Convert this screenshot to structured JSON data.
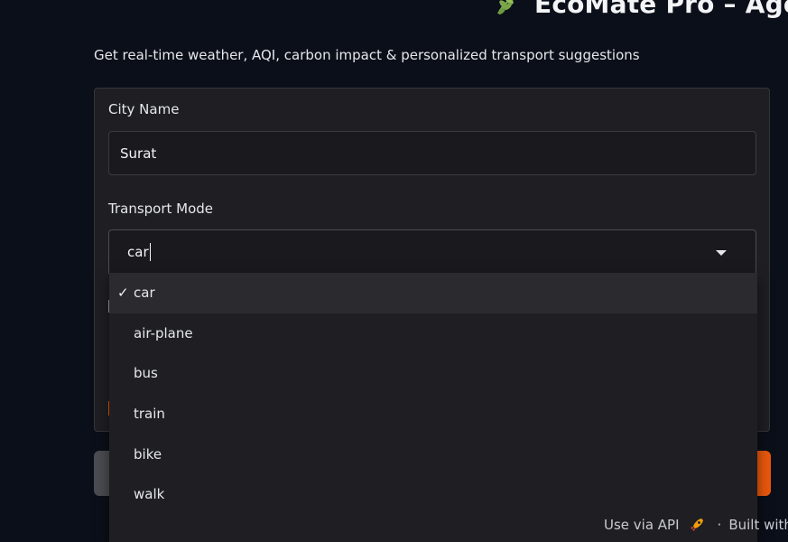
{
  "app": {
    "title": "EcoMate Pro – Agent",
    "subtitle": "Get real-time weather, AQI, carbon impact & personalized transport suggestions",
    "title_icon": "leaf-icon"
  },
  "form": {
    "city": {
      "label": "City Name",
      "value": "Surat"
    },
    "transport": {
      "label": "Transport Mode",
      "value": "car",
      "options": [
        {
          "label": "car",
          "selected": true,
          "check": "✓"
        },
        {
          "label": "air-plane",
          "selected": false
        },
        {
          "label": "bus",
          "selected": false
        },
        {
          "label": "train",
          "selected": false
        },
        {
          "label": "bike",
          "selected": false
        },
        {
          "label": "walk",
          "selected": false
        }
      ]
    }
  },
  "footer": {
    "api_link": "Use via API",
    "api_icon": "rocket-icon",
    "separator": "·",
    "built_with": "Built with G"
  },
  "colors": {
    "background": "#0b0f19",
    "panel": "#1f1f23",
    "accent": "#ea580c",
    "secondary_button": "#4b4c52"
  }
}
